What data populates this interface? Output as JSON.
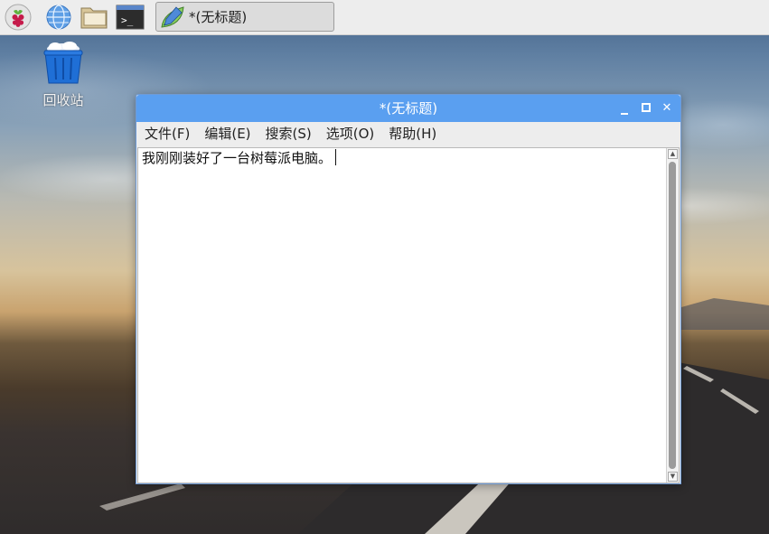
{
  "taskbar": {
    "launchers": [
      {
        "icon": "raspberry-menu-icon"
      },
      {
        "icon": "web-browser-icon"
      },
      {
        "icon": "file-manager-icon"
      },
      {
        "icon": "terminal-icon",
        "glyph": ">_"
      }
    ],
    "task_label": "*(无标题)",
    "task_icon": "text-editor-leaf-icon"
  },
  "desktop": {
    "trash_label": "回收站",
    "trash_icon": "trash-bin-icon"
  },
  "window": {
    "title": "*(无标题)",
    "controls": {
      "minimize": "‗",
      "maximize": "□",
      "close": "✕"
    },
    "menu": [
      {
        "label": "文件(F)"
      },
      {
        "label": "编辑(E)"
      },
      {
        "label": "搜索(S)"
      },
      {
        "label": "选项(O)"
      },
      {
        "label": "帮助(H)"
      }
    ],
    "editor": {
      "text": "我刚刚装好了一台树莓派电脑。"
    }
  },
  "colors": {
    "titlebar": "#5a9ff0",
    "taskbar": "#ededed",
    "trash_blue": "#1f6fd6"
  }
}
